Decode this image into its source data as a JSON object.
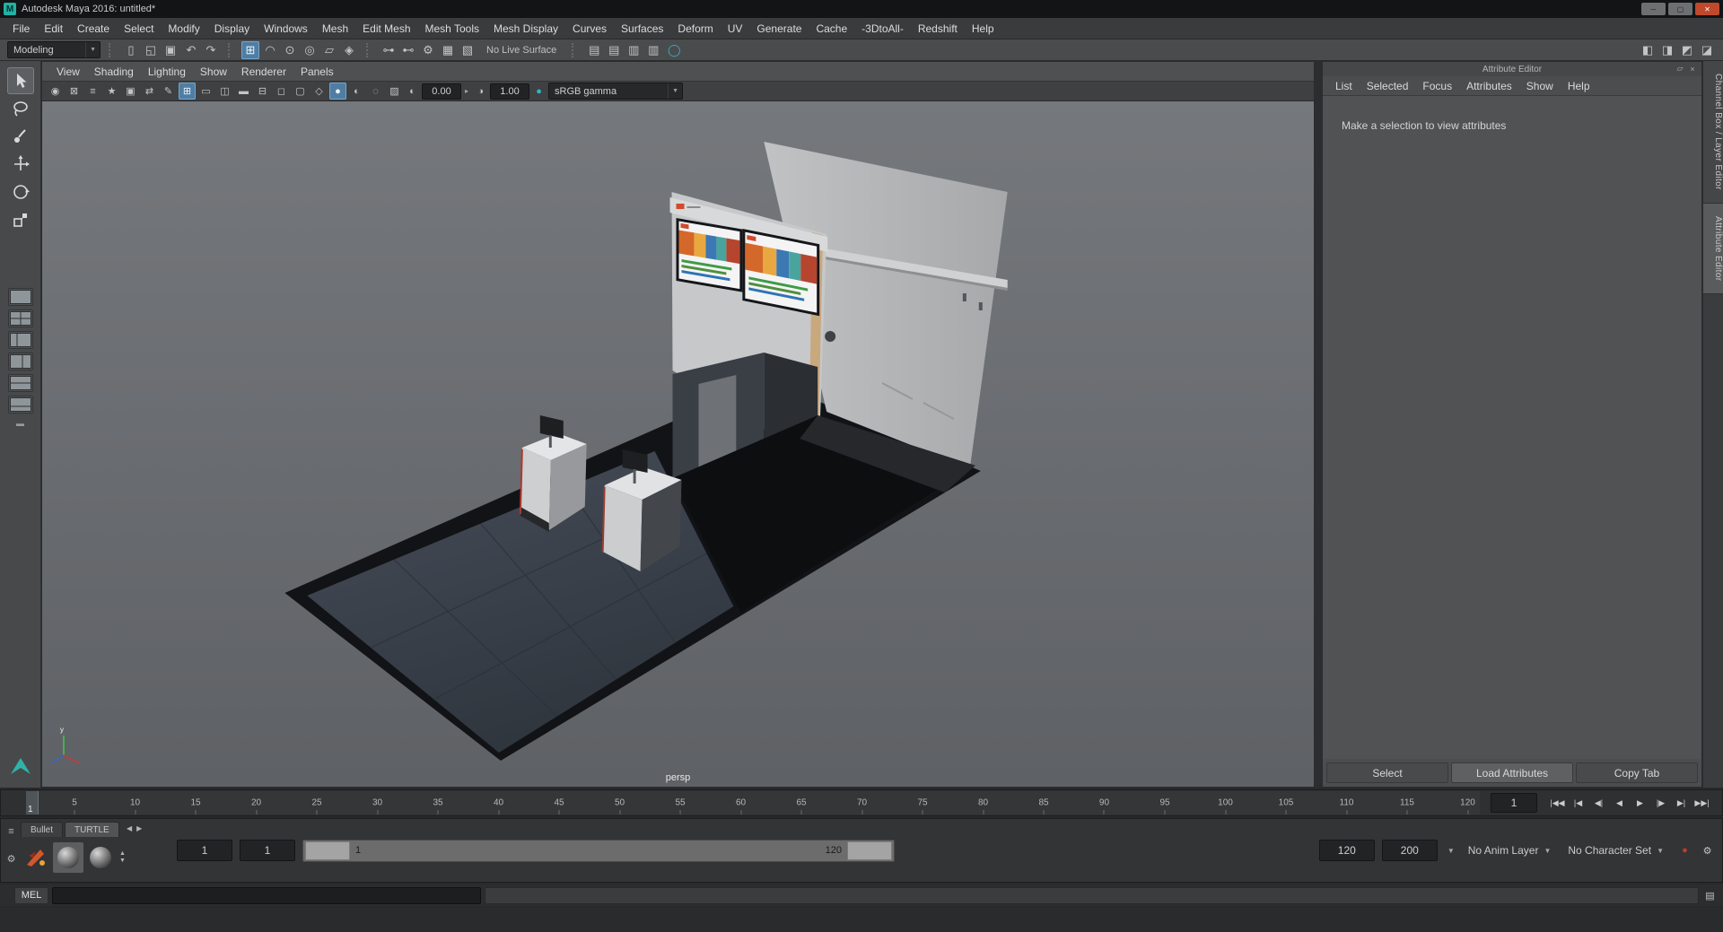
{
  "window": {
    "title": "Autodesk Maya 2016: untitled*",
    "controls": {
      "minimize": "─",
      "maximize": "▢",
      "close": "✕"
    }
  },
  "menubar": {
    "items": [
      "File",
      "Edit",
      "Create",
      "Select",
      "Modify",
      "Display",
      "Windows",
      "Mesh",
      "Edit Mesh",
      "Mesh Tools",
      "Mesh Display",
      "Curves",
      "Surfaces",
      "Deform",
      "UV",
      "Generate",
      "Cache",
      "-3DtoAll-",
      "Redshift",
      "Help"
    ]
  },
  "statusline": {
    "menuset": "Modeling",
    "no_live_surface": "No Live Surface",
    "file_icons": [
      {
        "name": "new-scene",
        "glyph": "▯"
      },
      {
        "name": "open-scene",
        "glyph": "◱"
      },
      {
        "name": "save-scene",
        "glyph": "▣"
      }
    ],
    "edit_icons": [
      {
        "name": "undo",
        "glyph": "↶"
      },
      {
        "name": "redo",
        "glyph": "↷"
      }
    ],
    "snap_icons": [
      {
        "name": "snap-to-grid",
        "glyph": "⊞",
        "active": true
      },
      {
        "name": "snap-to-curve",
        "glyph": "◠"
      },
      {
        "name": "snap-to-point",
        "glyph": "⊙"
      },
      {
        "name": "snap-to-projected-center",
        "glyph": "◎"
      },
      {
        "name": "snap-to-view-plane",
        "glyph": "▱"
      },
      {
        "name": "make-object-live",
        "glyph": "◈"
      }
    ],
    "history_icons": [
      {
        "name": "input-connections",
        "glyph": "⊶"
      },
      {
        "name": "output-connections",
        "glyph": "⊷"
      },
      {
        "name": "construction-history",
        "glyph": "⚙"
      },
      {
        "name": "render-current-frame",
        "glyph": "▦"
      },
      {
        "name": "ipr-render",
        "glyph": "▧"
      }
    ],
    "display_icons": [
      {
        "name": "poly-count-verts",
        "glyph": "▤"
      },
      {
        "name": "poly-count-edges",
        "glyph": "▤"
      },
      {
        "name": "poly-count-faces",
        "glyph": "▥"
      },
      {
        "name": "poly-count-tris",
        "glyph": "▥"
      }
    ],
    "sidebar_icons": [
      {
        "name": "show-attribute-editor",
        "glyph": "◧"
      },
      {
        "name": "show-tool-settings",
        "glyph": "◨"
      },
      {
        "name": "show-channel-box",
        "glyph": "◩"
      },
      {
        "name": "show-workspace",
        "glyph": "◪"
      }
    ]
  },
  "toolbox": {
    "tools": [
      {
        "name": "select-tool",
        "active": true
      },
      {
        "name": "lasso-tool"
      },
      {
        "name": "paint-select-tool"
      },
      {
        "name": "move-tool"
      },
      {
        "name": "rotate-tool"
      },
      {
        "name": "scale-tool"
      }
    ],
    "layouts": [
      {
        "name": "layout-single-pane"
      },
      {
        "name": "layout-four-pane"
      },
      {
        "name": "layout-persp-outliner"
      },
      {
        "name": "layout-two-pane-side"
      },
      {
        "name": "layout-two-pane-stacked"
      },
      {
        "name": "layout-persp-graph"
      }
    ]
  },
  "panel": {
    "menu": [
      "View",
      "Shading",
      "Lighting",
      "Show",
      "Renderer",
      "Panels"
    ],
    "icons": [
      {
        "name": "select-camera",
        "glyph": "◉"
      },
      {
        "name": "lock-camera",
        "glyph": "⊠"
      },
      {
        "name": "camera-attributes",
        "glyph": "≡"
      },
      {
        "name": "bookmarks",
        "glyph": "★"
      },
      {
        "name": "image-plane",
        "glyph": "▣"
      },
      {
        "name": "two-d-pan-zoom",
        "glyph": "⇄"
      },
      {
        "name": "grease-pencil",
        "glyph": "✎"
      },
      {
        "name": "grid",
        "glyph": "⊞",
        "active": true
      },
      {
        "name": "film-gate",
        "glyph": "▭"
      },
      {
        "name": "resolution-gate",
        "glyph": "◫"
      },
      {
        "name": "gate-mask",
        "glyph": "▬"
      },
      {
        "name": "field-chart",
        "glyph": "⊟"
      },
      {
        "name": "safe-action",
        "glyph": "◻"
      },
      {
        "name": "safe-title",
        "glyph": "▢"
      },
      {
        "name": "wireframe",
        "glyph": "◇"
      },
      {
        "name": "smooth-shade-all",
        "glyph": "●",
        "active": true
      },
      {
        "name": "textured",
        "glyph": "◐"
      },
      {
        "name": "use-default-material",
        "glyph": "◌"
      },
      {
        "name": "xray",
        "glyph": "▨"
      }
    ],
    "exposure": "0.00",
    "gamma": "1.00",
    "view_transform": "sRGB gamma",
    "camera_label": "persp"
  },
  "attribute_editor": {
    "title": "Attribute Editor",
    "menu": [
      "List",
      "Selected",
      "Focus",
      "Attributes",
      "Show",
      "Help"
    ],
    "message": "Make a selection to view attributes",
    "buttons": [
      "Select",
      "Load Attributes",
      "Copy Tab"
    ]
  },
  "side_tabs": [
    {
      "label": "Channel Box / Layer Editor"
    },
    {
      "label": "Attribute Editor",
      "active": true
    }
  ],
  "timeline": {
    "current_frame": "1",
    "frame_field": "1",
    "tick_labels": [
      5,
      10,
      15,
      20,
      25,
      30,
      35,
      40,
      45,
      50,
      55,
      60,
      65,
      70,
      75,
      80,
      85,
      90,
      95,
      100,
      105,
      110,
      115,
      120
    ]
  },
  "playback": [
    {
      "name": "go-to-start",
      "glyph": "|◀◀"
    },
    {
      "name": "step-back-key",
      "glyph": "|◀"
    },
    {
      "name": "step-back-frame",
      "glyph": "◀|"
    },
    {
      "name": "play-backwards",
      "glyph": "◀"
    },
    {
      "name": "play-forwards",
      "glyph": "▶"
    },
    {
      "name": "step-forward-frame",
      "glyph": "|▶"
    },
    {
      "name": "step-forward-key",
      "glyph": "▶|"
    },
    {
      "name": "go-to-end",
      "glyph": "▶▶|"
    }
  ],
  "range_slider": {
    "animation_start": "1",
    "playback_start": "1",
    "handle_start_label": "1",
    "handle_end_label": "120",
    "playback_end": "120",
    "animation_end": "200",
    "anim_layer": "No Anim Layer",
    "character_set": "No Character Set"
  },
  "shelf": {
    "tabs": [
      {
        "label": "Bullet"
      },
      {
        "label": "TURTLE",
        "active": true
      }
    ],
    "buttons": [
      {
        "name": "turtle-bake-icon"
      },
      {
        "name": "turtle-sphere-1-icon",
        "selected": true
      },
      {
        "name": "turtle-sphere-2-icon"
      }
    ]
  },
  "command_line": {
    "label": "MEL"
  }
}
